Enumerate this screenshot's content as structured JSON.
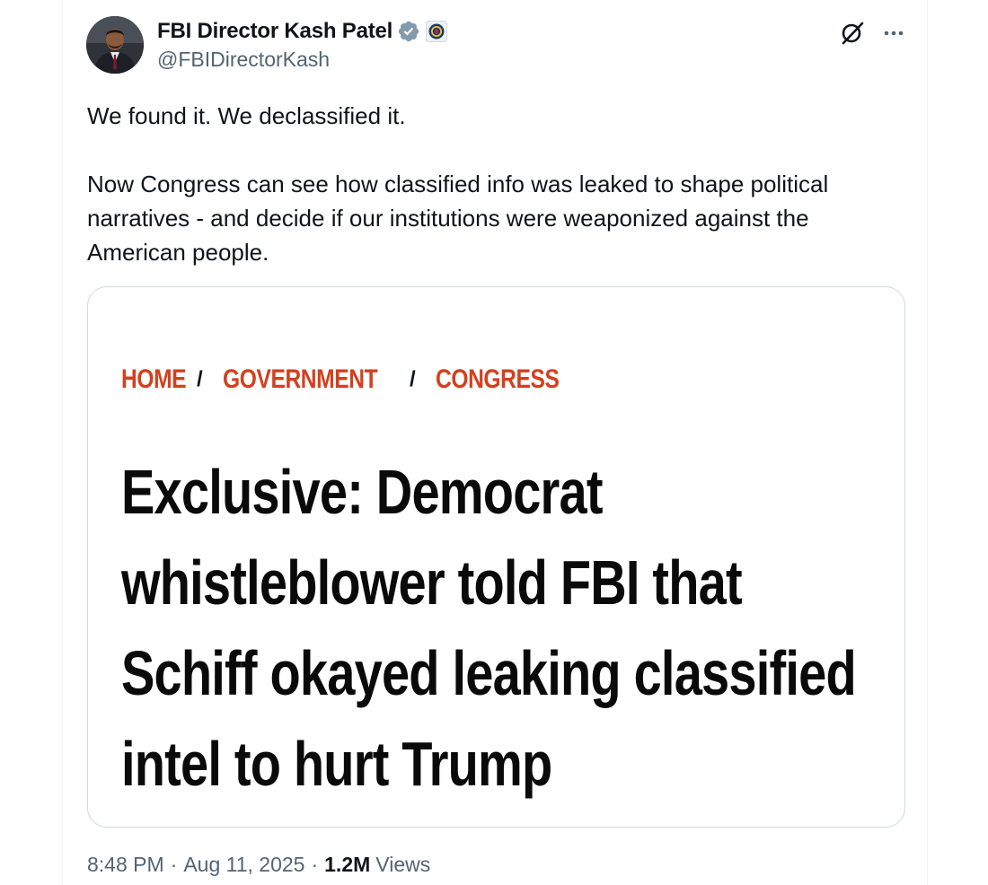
{
  "author": {
    "display_name": "FBI Director Kash Patel",
    "handle": "@FBIDirectorKash"
  },
  "tweet": {
    "line_1": "We found it. We declassified it.",
    "line_2": "Now Congress can see how classified info was leaked to shape political",
    "line_3": "narratives - and decide if our institutions were weaponized against the",
    "line_4": "American people."
  },
  "card": {
    "breadcrumb": {
      "home": "HOME",
      "separator": "/",
      "section": "GOVERNMENT",
      "subsection": "CONGRESS"
    },
    "headline_lines": [
      "Exclusive: Democrat",
      "whistleblower told FBI that",
      "Schiff okayed leaking classified",
      "intel to hurt Trump"
    ]
  },
  "meta": {
    "time": "8:48 PM",
    "date": "Aug 11, 2025",
    "views_count": "1.2M",
    "views_label": "Views",
    "separator": "·"
  },
  "icons": {
    "verified": "verified-badge-icon",
    "affiliate": "fbi-seal-icon",
    "grok": "grok-icon",
    "more": "more-icon"
  },
  "colors": {
    "breadcrumb_red": "#d2401f",
    "verified_gray": "#829aab",
    "secondary_text": "#536471"
  }
}
